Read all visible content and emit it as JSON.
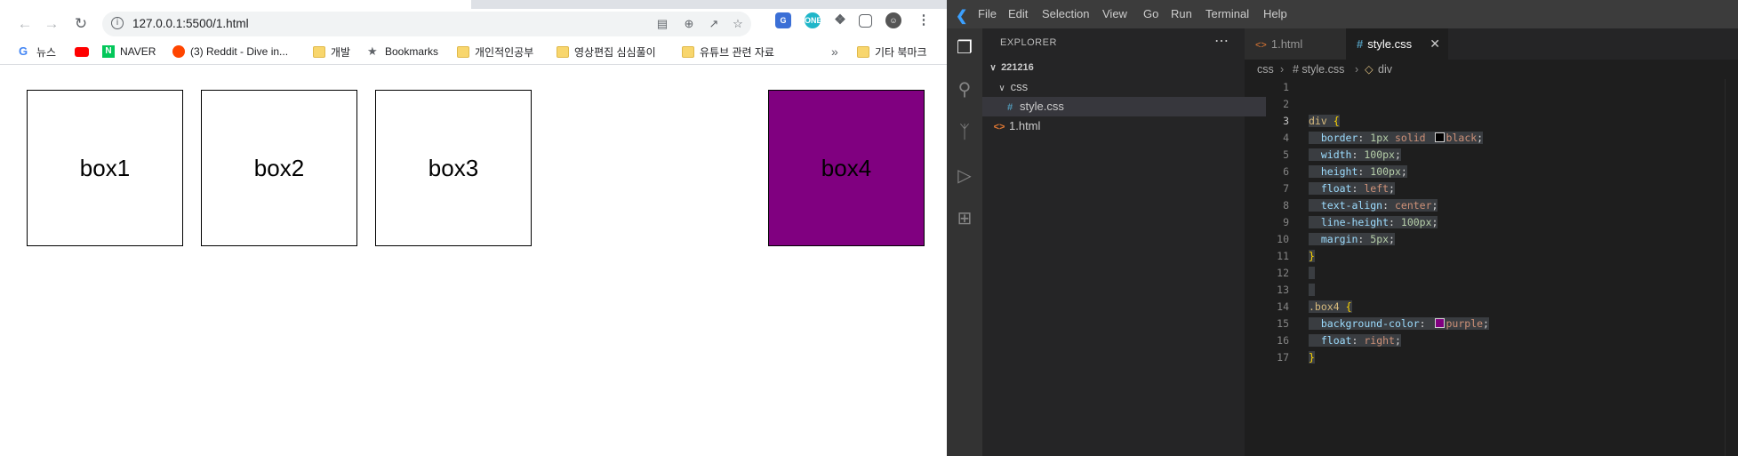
{
  "browser": {
    "url": "127.0.0.1:5500/1.html",
    "bookmarks": [
      {
        "label": "뉴스",
        "icon": "google-icon"
      },
      {
        "label": "",
        "icon": "youtube-icon"
      },
      {
        "label": "NAVER",
        "icon": "naver-icon"
      },
      {
        "label": "(3) Reddit - Dive in...",
        "icon": "reddit-icon"
      },
      {
        "label": "개발",
        "icon": "folder-icon"
      },
      {
        "label": "Bookmarks",
        "icon": "star-icon"
      },
      {
        "label": "개인적인공부",
        "icon": "folder-icon"
      },
      {
        "label": "영상편집 심심풀이",
        "icon": "folder-icon"
      },
      {
        "label": "유튜브 관련 자료",
        "icon": "folder-icon"
      }
    ],
    "overflow": "»",
    "other_bookmarks": "기타 북마크",
    "boxes": [
      {
        "label": "box1",
        "color": "#ffffff"
      },
      {
        "label": "box2",
        "color": "#ffffff"
      },
      {
        "label": "box3",
        "color": "#ffffff"
      },
      {
        "label": "box4",
        "color": "#800080"
      }
    ]
  },
  "vscode": {
    "menu": [
      "File",
      "Edit",
      "Selection",
      "View",
      "Go",
      "Run",
      "Terminal",
      "Help"
    ],
    "explorer": {
      "title": "EXPLORER",
      "root": "221216",
      "folder": "css",
      "files": [
        "style.css",
        "1.html"
      ]
    },
    "tabs": [
      {
        "label": "1.html",
        "icon": "<>"
      },
      {
        "label": "style.css",
        "icon": "#"
      }
    ],
    "breadcrumb": [
      "css",
      "# style.css",
      "div"
    ],
    "code": {
      "line_numbers": [
        "1",
        "2",
        "3",
        "4",
        "5",
        "6",
        "7",
        "8",
        "9",
        "10",
        "11",
        "12",
        "13",
        "14",
        "15",
        "16",
        "17"
      ],
      "div_selector": "div",
      "box4_selector": ".box4",
      "props": {
        "border": {
          "name": "border",
          "num": "1px",
          "val": "solid",
          "color": "black",
          "swatch": "#000000"
        },
        "width": {
          "name": "width",
          "num": "100px"
        },
        "height": {
          "name": "height",
          "num": "100px"
        },
        "float": {
          "name": "float",
          "val": "left"
        },
        "text_align": {
          "name": "text-align",
          "val": "center"
        },
        "line_height": {
          "name": "line-height",
          "num": "100px"
        },
        "margin": {
          "name": "margin",
          "num": "5px"
        },
        "bg": {
          "name": "background-color",
          "color": "purple",
          "swatch": "#800080"
        },
        "float2": {
          "name": "float",
          "val": "right"
        }
      }
    }
  }
}
